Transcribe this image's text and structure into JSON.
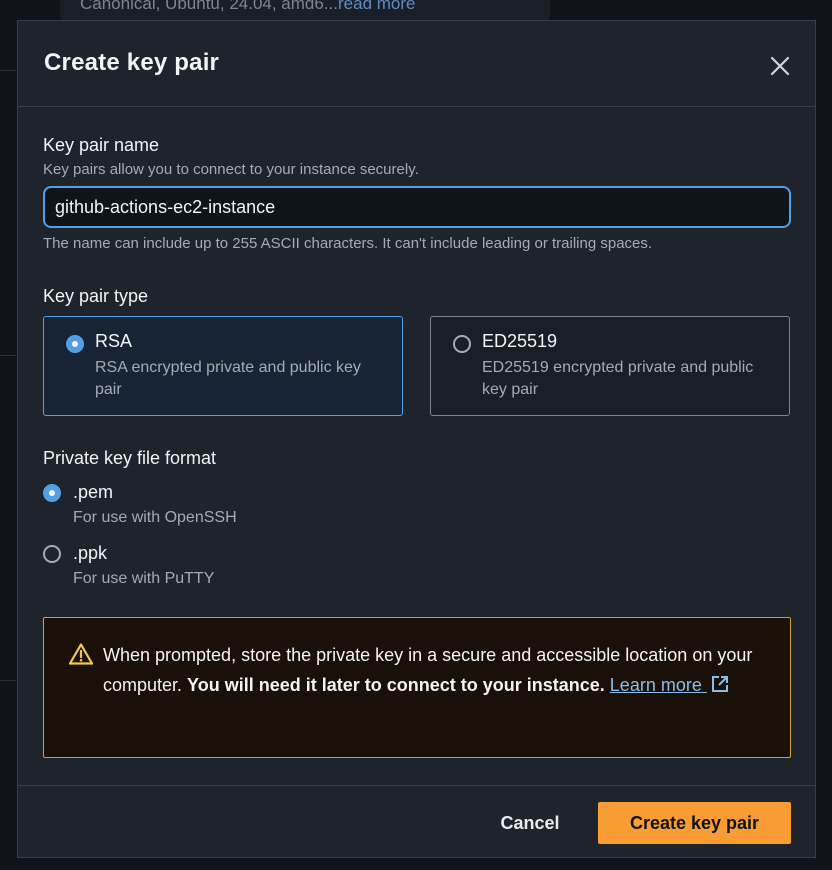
{
  "background": {
    "card_text": "Canonical, Ubuntu, 24.04, amd6...",
    "card_link": "read more"
  },
  "modal": {
    "title": "Create key pair",
    "close_icon": "close-icon"
  },
  "key_pair_name": {
    "label": "Key pair name",
    "description": "Key pairs allow you to connect to your instance securely.",
    "value": "github-actions-ec2-instance",
    "constraint": "The name can include up to 255 ASCII characters. It can't include leading or trailing spaces."
  },
  "key_pair_type": {
    "label": "Key pair type",
    "options": [
      {
        "title": "RSA",
        "description": "RSA encrypted private and public key pair",
        "selected": true
      },
      {
        "title": "ED25519",
        "description": "ED25519 encrypted private and public key pair",
        "selected": false
      }
    ]
  },
  "private_key_format": {
    "label": "Private key file format",
    "options": [
      {
        "title": ".pem",
        "description": "For use with OpenSSH",
        "selected": true
      },
      {
        "title": ".ppk",
        "description": "For use with PuTTY",
        "selected": false
      }
    ]
  },
  "alert": {
    "icon": "warning-icon",
    "text_normal": "When prompted, store the private key in a secure and accessible location on your computer. ",
    "text_bold": "You will need it later to connect to your instance.",
    "link_text": "Learn more",
    "link_icon": "external-link-icon"
  },
  "footer": {
    "cancel_label": "Cancel",
    "create_label": "Create key pair"
  },
  "colors": {
    "accent": "#539fe5",
    "primary_button": "#f89c33",
    "warning_border": "#d89c2b",
    "modal_bg": "#1f232b"
  }
}
